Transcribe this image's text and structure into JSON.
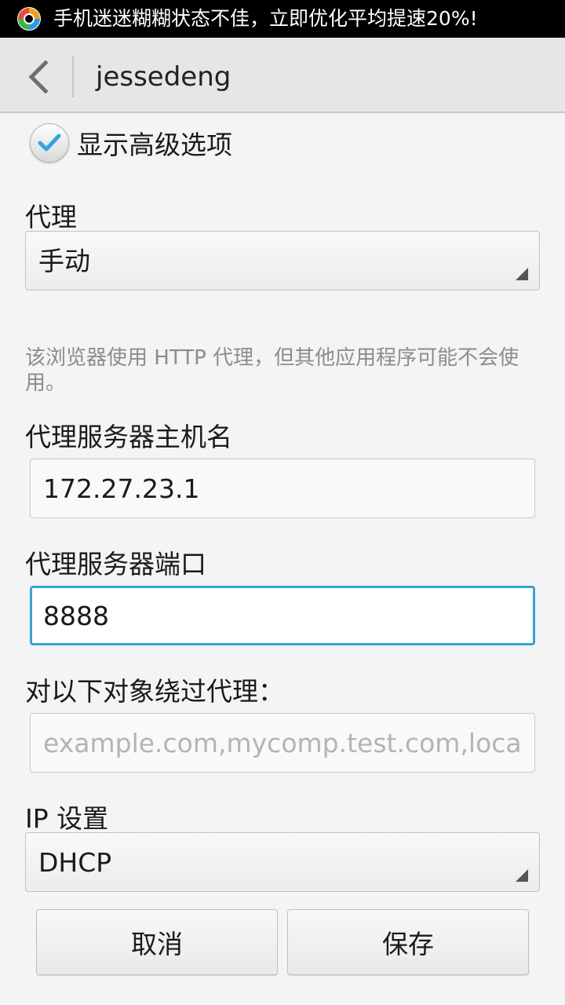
{
  "status_bar": {
    "logo_icon": "app-logo-icon",
    "notification_text": "手机迷迷糊糊状态不佳，立即优化平均提速20%!"
  },
  "action_bar": {
    "back_icon": "chevron-left-icon",
    "title": "jessedeng"
  },
  "advanced_options": {
    "checked": true,
    "label": "显示高级选项"
  },
  "proxy": {
    "label": "代理",
    "selected": "手动",
    "hint": "该浏览器使用 HTTP 代理，但其他应用程序可能不会使用。"
  },
  "proxy_host": {
    "label": "代理服务器主机名",
    "value": "172.27.23.1"
  },
  "proxy_port": {
    "label": "代理服务器端口",
    "value": "8888"
  },
  "bypass": {
    "label": "对以下对象绕过代理：",
    "placeholder": "example.com,mycomp.test.com,localhost"
  },
  "ip_settings": {
    "label": "IP 设置",
    "selected": "DHCP"
  },
  "buttons": {
    "cancel": "取消",
    "save": "保存"
  },
  "colors": {
    "focus_accent": "#36a5d6",
    "check_mark": "#33a5dd"
  }
}
